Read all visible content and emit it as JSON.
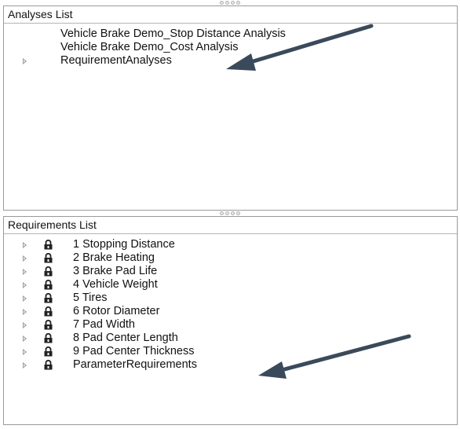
{
  "analyses_panel": {
    "header": "Analyses List",
    "items": [
      {
        "label": "Vehicle Brake Demo_Stop Distance Analysis",
        "expandable": false
      },
      {
        "label": "Vehicle Brake Demo_Cost Analysis",
        "expandable": false
      },
      {
        "label": "RequirementAnalyses",
        "expandable": true
      }
    ]
  },
  "requirements_panel": {
    "header": "Requirements List",
    "items": [
      {
        "label": "1 Stopping Distance"
      },
      {
        "label": "2 Brake Heating"
      },
      {
        "label": "3 Brake Pad Life"
      },
      {
        "label": "4 Vehicle Weight"
      },
      {
        "label": "5 Tires"
      },
      {
        "label": "6 Rotor Diameter"
      },
      {
        "label": "7 Pad Width"
      },
      {
        "label": "8 Pad Center Length"
      },
      {
        "label": "9 Pad Center Thickness"
      },
      {
        "label": "ParameterRequirements"
      }
    ]
  },
  "colors": {
    "arrow": "#3a4a5a",
    "lock": "#222222",
    "border": "#9a9a9a"
  },
  "icons": {
    "tree_item": "lock-icon",
    "expander": "expand-triangle-icon",
    "annotation": "arrow-icon"
  }
}
